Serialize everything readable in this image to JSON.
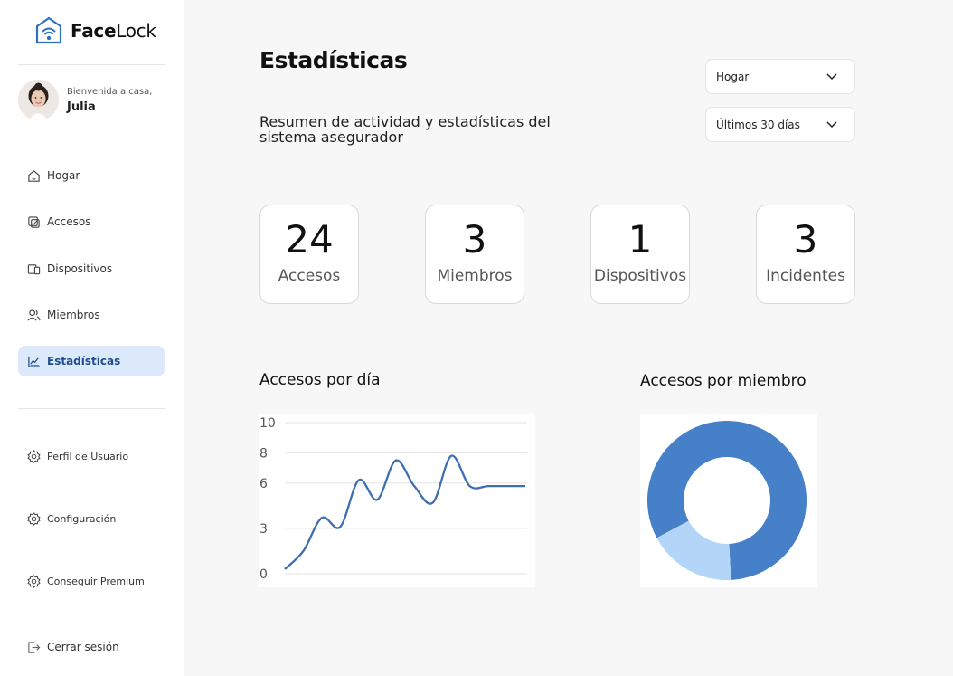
{
  "brand": {
    "name_bold": "Face",
    "name_light": "Lock"
  },
  "user": {
    "welcome": "Bienvenida a casa,",
    "name": "Julia"
  },
  "nav": {
    "items": [
      {
        "label": "Hogar",
        "icon": "home-icon"
      },
      {
        "label": "Accesos",
        "icon": "access-icon"
      },
      {
        "label": "Dispositivos",
        "icon": "devices-icon"
      },
      {
        "label": "Miembros",
        "icon": "members-icon"
      },
      {
        "label": "Estadísticas",
        "icon": "stats-icon",
        "active": true
      }
    ],
    "secondary": [
      {
        "label": "Perfil de Usuario",
        "icon": "gear-icon"
      },
      {
        "label": "Configuración",
        "icon": "gear-icon"
      },
      {
        "label": "Conseguir Premium",
        "icon": "gear-icon"
      }
    ],
    "logout": {
      "label": "Cerrar sesión",
      "icon": "logout-icon"
    }
  },
  "page": {
    "title": "Estadísticas",
    "subtitle": "Resumen de actividad y estadísticas del sistema asegurador"
  },
  "filters": {
    "location": "Hogar",
    "period": "Últimos 30 días"
  },
  "stats": [
    {
      "value": "24",
      "label": "Accesos"
    },
    {
      "value": "3",
      "label": "Miembros"
    },
    {
      "value": "1",
      "label": "Dispositivos"
    },
    {
      "value": "3",
      "label": "Incidentes"
    }
  ],
  "charts": {
    "line_title": "Accesos por día",
    "donut_title": "Accesos por miembro"
  },
  "colors": {
    "accent": "#4580c8",
    "accent_light": "#b3d5f8",
    "active_bg": "#dce9fb"
  },
  "chart_data": [
    {
      "type": "line",
      "title": "Accesos por día",
      "yticks": [
        "10",
        "8",
        "6",
        "3",
        "0"
      ],
      "ylim": [
        0,
        10
      ],
      "x": [
        0,
        1,
        2,
        3,
        4,
        5,
        6,
        7,
        8,
        9,
        10,
        11,
        12,
        13
      ],
      "values": [
        0.3,
        1.5,
        3.7,
        3.1,
        6.2,
        4.9,
        7.5,
        5.8,
        4.7,
        7.8,
        5.8,
        5.8,
        5.8,
        5.8
      ],
      "grid": true
    },
    {
      "type": "pie",
      "title": "Accesos por miembro",
      "donut": true,
      "values": [
        82,
        18
      ],
      "colors": [
        "#4580c8",
        "#b3d5f8"
      ]
    }
  ]
}
